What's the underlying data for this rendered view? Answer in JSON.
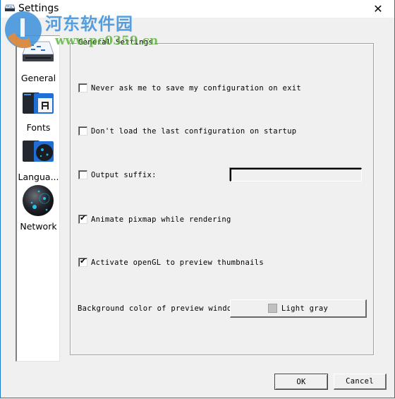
{
  "window": {
    "title": "Settings",
    "close_glyph": "✕",
    "title_icon": "settings-drive-icon",
    "border_color": "#1979CA"
  },
  "watermark": {
    "chinese_text": "河东软件园",
    "url_text": "www.pc0359.cn"
  },
  "sidebar": {
    "items": [
      {
        "label": "General",
        "icon": "general-drive-icon"
      },
      {
        "label": "Fonts",
        "icon": "fonts-icon"
      },
      {
        "label": "Langua...",
        "icon": "language-icon"
      },
      {
        "label": "Network",
        "icon": "network-globe-icon"
      }
    ]
  },
  "general_settings": {
    "group_title": "General Settings",
    "options": [
      {
        "label": "Never ask me to save my configuration on exit",
        "checked": false
      },
      {
        "label": "Don't load the last configuration on startup",
        "checked": false
      },
      {
        "label": "Output suffix:",
        "checked": false
      },
      {
        "label": "Animate pixmap while rendering",
        "checked": true
      },
      {
        "label": "Activate openGL to preview thumbnails",
        "checked": true
      }
    ],
    "output_suffix_value": "",
    "background_color_label": "Background color of preview window:",
    "background_color_value": "Light gray",
    "background_color_swatch": "#C0C0C0"
  },
  "buttons": {
    "ok": "OK",
    "cancel": "Cancel"
  },
  "check_glyph": "✔"
}
